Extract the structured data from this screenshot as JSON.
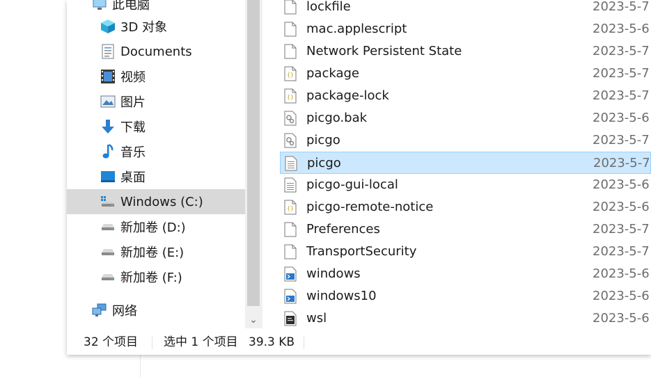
{
  "nav": {
    "items": [
      {
        "label": "此电脑",
        "icon": "computer-icon"
      },
      {
        "label": "3D 对象",
        "icon": "cube-3d-icon"
      },
      {
        "label": "Documents",
        "icon": "document-icon"
      },
      {
        "label": "视频",
        "icon": "video-icon"
      },
      {
        "label": "图片",
        "icon": "picture-icon"
      },
      {
        "label": "下载",
        "icon": "download-arrow-icon"
      },
      {
        "label": "音乐",
        "icon": "music-note-icon"
      },
      {
        "label": "桌面",
        "icon": "desktop-icon"
      },
      {
        "label": "Windows (C:)",
        "icon": "windows-drive-icon"
      },
      {
        "label": "新加卷 (D:)",
        "icon": "drive-icon"
      },
      {
        "label": "新加卷 (E:)",
        "icon": "drive-icon"
      },
      {
        "label": "新加卷 (F:)",
        "icon": "drive-icon"
      },
      {
        "label": "网络",
        "icon": "network-icon"
      }
    ],
    "selected_index": 8
  },
  "files": [
    {
      "name": "lockfile",
      "date": "2023-5-7",
      "icon": "blank-file-icon"
    },
    {
      "name": "mac.applescript",
      "date": "2023-5-6",
      "icon": "blank-file-icon"
    },
    {
      "name": "Network Persistent State",
      "date": "2023-5-7",
      "icon": "blank-file-icon"
    },
    {
      "name": "package",
      "date": "2023-5-7",
      "icon": "json-file-icon"
    },
    {
      "name": "package-lock",
      "date": "2023-5-7",
      "icon": "json-file-icon"
    },
    {
      "name": "picgo.bak",
      "date": "2023-5-6",
      "icon": "config-file-icon"
    },
    {
      "name": "picgo",
      "date": "2023-5-7",
      "icon": "config-file-icon"
    },
    {
      "name": "picgo",
      "date": "2023-5-7",
      "icon": "text-file-icon"
    },
    {
      "name": "picgo-gui-local",
      "date": "2023-5-6",
      "icon": "text-file-icon"
    },
    {
      "name": "picgo-remote-notice",
      "date": "2023-5-6",
      "icon": "json-file-icon"
    },
    {
      "name": "Preferences",
      "date": "2023-5-7",
      "icon": "blank-file-icon"
    },
    {
      "name": "TransportSecurity",
      "date": "2023-5-7",
      "icon": "blank-file-icon"
    },
    {
      "name": "windows",
      "date": "2023-5-6",
      "icon": "script-file-icon"
    },
    {
      "name": "windows10",
      "date": "2023-5-6",
      "icon": "script-file-icon"
    },
    {
      "name": "wsl",
      "date": "2023-5-6",
      "icon": "shell-file-icon"
    }
  ],
  "selected_file_index": 7,
  "status": {
    "item_count": "32 个项目",
    "selected": "选中 1 个项目",
    "size": "39.3 KB"
  },
  "colors": {
    "selection_fill": "#cce8ff",
    "selection_border": "#99d1ff",
    "nav_selected": "#d9d9d9",
    "date_text": "#6d6d6d"
  }
}
